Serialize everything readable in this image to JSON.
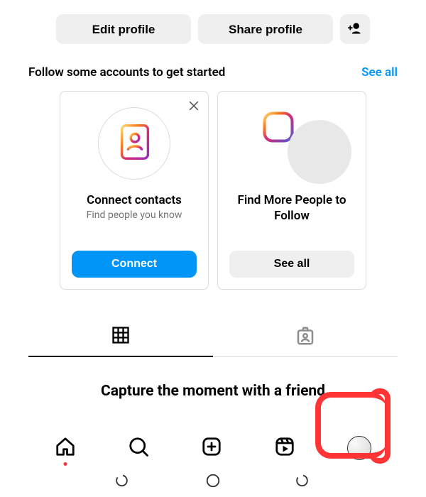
{
  "actions": {
    "edit_profile": "Edit profile",
    "share_profile": "Share profile"
  },
  "discover": {
    "title": "Follow some accounts to get started",
    "see_all": "See all",
    "cards": [
      {
        "title": "Connect contacts",
        "subtitle": "Find people you know",
        "button": "Connect"
      },
      {
        "title": "Find More People to Follow",
        "subtitle": "",
        "button": "See all"
      }
    ]
  },
  "prompt": {
    "text": "Capture the moment with a friend"
  }
}
